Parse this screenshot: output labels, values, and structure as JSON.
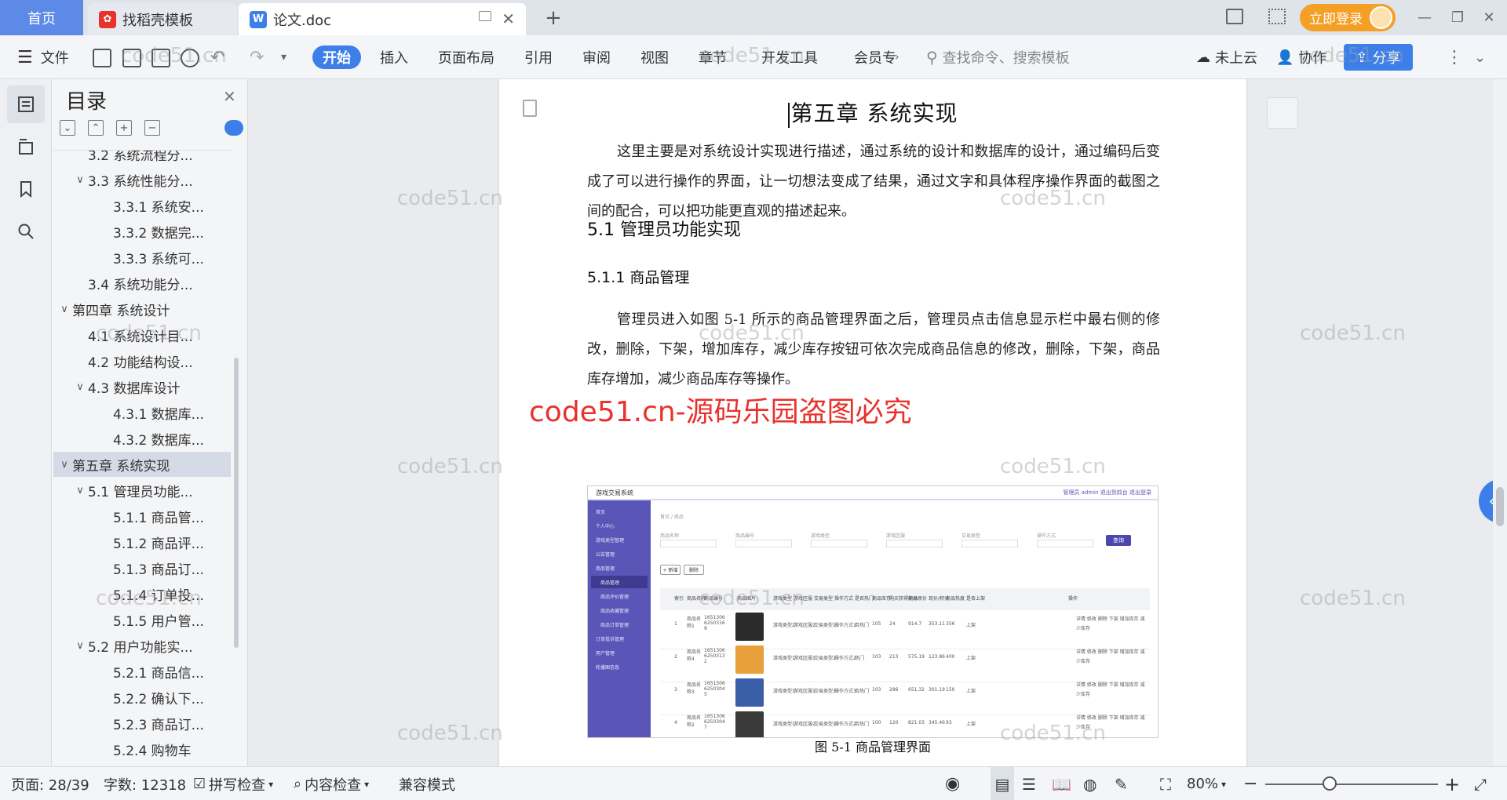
{
  "tabs": {
    "home": "首页",
    "daoke": "找稻壳模板",
    "doc": "论文.doc",
    "login": "立即登录"
  },
  "toolbar": {
    "file": "文件",
    "menu": [
      "开始",
      "插入",
      "页面布局",
      "引用",
      "审阅",
      "视图",
      "章节",
      "开发工具",
      "会员专"
    ],
    "search_placeholder": "查找命令、搜索模板",
    "cloud": "未上云",
    "collab": "协作",
    "share": "分享"
  },
  "toc": {
    "title": "目录",
    "items": [
      {
        "label": "3.2 系统流程分...",
        "level": 2,
        "caret": ""
      },
      {
        "label": "3.3 系统性能分...",
        "level": 2,
        "caret": "∨"
      },
      {
        "label": "3.3.1 系统安...",
        "level": 3,
        "caret": ""
      },
      {
        "label": "3.3.2 数据完...",
        "level": 3,
        "caret": ""
      },
      {
        "label": "3.3.3 系统可...",
        "level": 3,
        "caret": ""
      },
      {
        "label": "3.4 系统功能分...",
        "level": 2,
        "caret": ""
      },
      {
        "label": "第四章  系统设计",
        "level": 1,
        "caret": "∨"
      },
      {
        "label": "4.1  系统设计目...",
        "level": 2,
        "caret": ""
      },
      {
        "label": "4.2 功能结构设...",
        "level": 2,
        "caret": ""
      },
      {
        "label": "4.3 数据库设计",
        "level": 2,
        "caret": "∨"
      },
      {
        "label": "4.3.1  数据库...",
        "level": 3,
        "caret": ""
      },
      {
        "label": "4.3.2  数据库...",
        "level": 3,
        "caret": ""
      },
      {
        "label": "第五章  系统实现",
        "level": 1,
        "caret": "∨",
        "active": true
      },
      {
        "label": "5.1 管理员功能...",
        "level": 2,
        "caret": "∨"
      },
      {
        "label": "5.1.1  商品管...",
        "level": 3,
        "caret": ""
      },
      {
        "label": "5.1.2  商品评...",
        "level": 3,
        "caret": ""
      },
      {
        "label": "5.1.3  商品订...",
        "level": 3,
        "caret": ""
      },
      {
        "label": "5.1.4  订单投...",
        "level": 3,
        "caret": ""
      },
      {
        "label": "5.1.5  用户管...",
        "level": 3,
        "caret": ""
      },
      {
        "label": "5.2  用户功能实...",
        "level": 2,
        "caret": "∨"
      },
      {
        "label": "5.2.1  商品信...",
        "level": 3,
        "caret": ""
      },
      {
        "label": "5.2.2  确认下...",
        "level": 3,
        "caret": ""
      },
      {
        "label": "5.2.3  商品订...",
        "level": 3,
        "caret": ""
      },
      {
        "label": "5.2.4  购物车",
        "level": 3,
        "caret": ""
      }
    ]
  },
  "document": {
    "chapter_title": "第五章  系统实现",
    "intro": "这里主要是对系统设计实现进行描述，通过系统的设计和数据库的设计，通过编码后变成了可以进行操作的界面，让一切想法变成了结果，通过文字和具体程序操作界面的截图之间的配合，可以把功能更直观的描述起来。",
    "h2": "5.1 管理员功能实现",
    "h3": "5.1.1  商品管理",
    "para": "管理员进入如图 5-1 所示的商品管理界面之后，管理员点击信息显示栏中最右侧的修改，删除，下架，增加库存，减少库存按钮可依次完成商品信息的修改，删除，下架，商品库存增加，减少商品库存等操作。",
    "caption": "图 5-1  商品管理界面"
  },
  "figure": {
    "app_title": "游戏交易系统",
    "top_links": "管理员 admin   退出到前台   退出登录",
    "breadcrumb": "首页 / 商品",
    "menu": [
      "首页",
      "个人中心",
      "游戏类型管理",
      "公告管理",
      "商品管理",
      "商品管理",
      "商品评价管理",
      "商品收藏管理",
      "商品订单管理",
      "订单投诉管理",
      "用户管理",
      "轮播图信息"
    ],
    "filters": [
      "商品名称",
      "商品编号",
      "游戏类型",
      "游戏区服",
      "交易类型",
      "操作方式"
    ],
    "search_btn": "查询",
    "add_btn": "+ 新增",
    "del_btn": "删除",
    "columns": [
      "索引",
      "商品名称",
      "商品编号",
      "商品图片",
      "游戏类型",
      "游戏区服",
      "交易类型",
      "操作方式",
      "是否热门",
      "商品库存",
      "购买获得积分",
      "商品原价",
      "现价/积分",
      "商品热度",
      "是否上架",
      "操作"
    ],
    "rows": [
      {
        "idx": "1",
        "name": "商品名称1",
        "code": "1651306 6250316 9",
        "type": "游戏类型2",
        "server": "游戏区服2",
        "trade": "交易类型1",
        "op": "操作方式1",
        "hot": "否热门",
        "stock": "105",
        "pts": "24",
        "orig": "914.7",
        "price": "353.11",
        "heat": "356",
        "shelf": "上架"
      },
      {
        "idx": "2",
        "name": "商品名称4",
        "code": "1651306 6250313 2",
        "type": "游戏类型1",
        "server": "游戏区服1",
        "trade": "交易类型2",
        "op": "操作方式2",
        "hot": "热门",
        "stock": "103",
        "pts": "213",
        "orig": "575.19",
        "price": "123.86",
        "heat": "400",
        "shelf": "上架"
      },
      {
        "idx": "3",
        "name": "商品名称3",
        "code": "1651306 6250304 5",
        "type": "游戏类型3",
        "server": "游戏区服1",
        "trade": "交易类型3",
        "op": "操作方式3",
        "hot": "否热门",
        "stock": "103",
        "pts": "286",
        "orig": "651.32",
        "price": "301.19",
        "heat": "150",
        "shelf": "上架"
      },
      {
        "idx": "4",
        "name": "商品名称2",
        "code": "1651306 6250304 7",
        "type": "游戏类型1",
        "server": "游戏区服2",
        "trade": "交易类型1",
        "op": "操作方式2",
        "hot": "否热门",
        "stock": "100",
        "pts": "120",
        "orig": "821.03",
        "price": "345.46",
        "heat": "93",
        "shelf": "上架"
      }
    ],
    "ops": "详情 修改 删除 下架 增加库存 减少库存"
  },
  "watermark": {
    "text": "code51.cn",
    "red": "code51.cn-源码乐园盗图必究"
  },
  "status": {
    "page": "页面: 28/39",
    "words": "字数: 12318",
    "spell": "拼写检查",
    "content": "内容检查",
    "mode": "兼容模式",
    "zoom": "80%"
  },
  "colors": {
    "accent": "#3d7fe8",
    "home_tab": "#5d8ae6",
    "login": "#f4a026",
    "figure_sidebar": "#5a56b8",
    "red_watermark": "#e8322c"
  }
}
